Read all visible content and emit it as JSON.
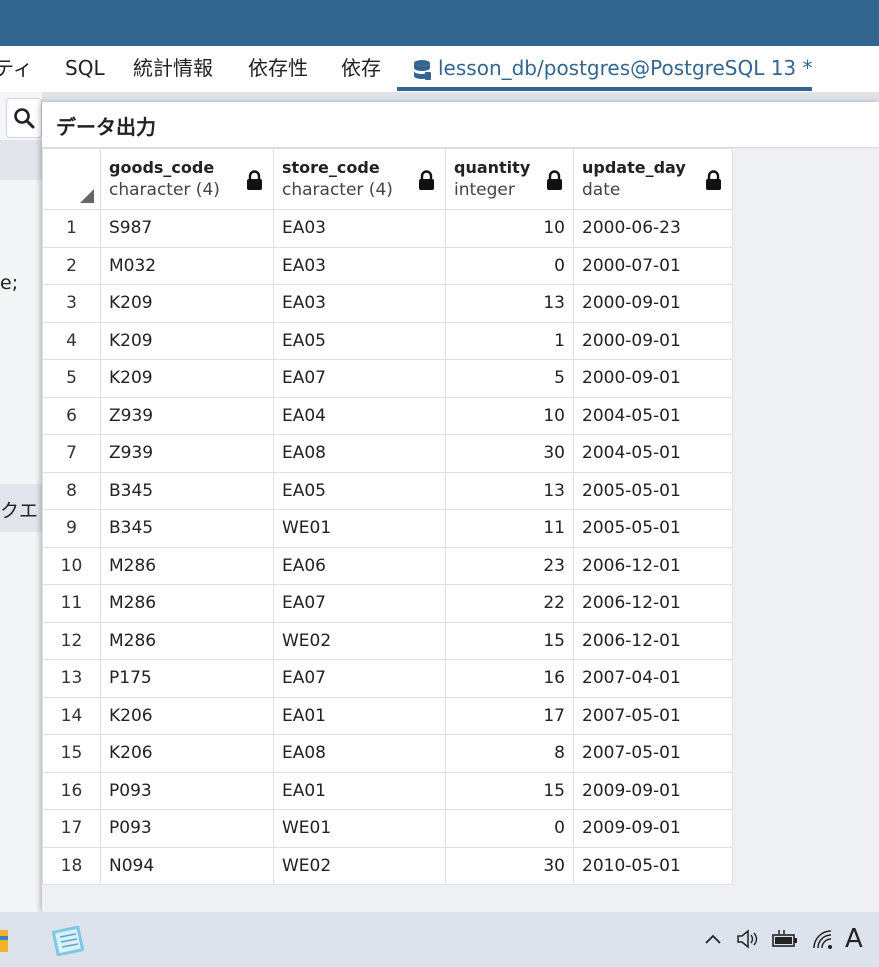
{
  "tabs": [
    {
      "label": "ティ"
    },
    {
      "label": "SQL"
    },
    {
      "label": "統計情報"
    },
    {
      "label": "依存性"
    },
    {
      "label": "依存"
    },
    {
      "label": "lesson_db/postgres@PostgreSQL 13 *"
    }
  ],
  "background_fragments": {
    "code_fragment": "e;",
    "query_fragment": "クエ"
  },
  "panel": {
    "title": "データ出力"
  },
  "columns": [
    {
      "name": "goods_code",
      "type": "character (4)"
    },
    {
      "name": "store_code",
      "type": "character (4)"
    },
    {
      "name": "quantity",
      "type": "integer"
    },
    {
      "name": "update_day",
      "type": "date"
    }
  ],
  "rows": [
    {
      "n": "1",
      "goods": "S987",
      "store": "EA03",
      "qty": "10",
      "date": "2000-06-23"
    },
    {
      "n": "2",
      "goods": "M032",
      "store": "EA03",
      "qty": "0",
      "date": "2000-07-01"
    },
    {
      "n": "3",
      "goods": "K209",
      "store": "EA03",
      "qty": "13",
      "date": "2000-09-01"
    },
    {
      "n": "4",
      "goods": "K209",
      "store": "EA05",
      "qty": "1",
      "date": "2000-09-01"
    },
    {
      "n": "5",
      "goods": "K209",
      "store": "EA07",
      "qty": "5",
      "date": "2000-09-01"
    },
    {
      "n": "6",
      "goods": "Z939",
      "store": "EA04",
      "qty": "10",
      "date": "2004-05-01"
    },
    {
      "n": "7",
      "goods": "Z939",
      "store": "EA08",
      "qty": "30",
      "date": "2004-05-01"
    },
    {
      "n": "8",
      "goods": "B345",
      "store": "EA05",
      "qty": "13",
      "date": "2005-05-01"
    },
    {
      "n": "9",
      "goods": "B345",
      "store": "WE01",
      "qty": "11",
      "date": "2005-05-01"
    },
    {
      "n": "10",
      "goods": "M286",
      "store": "EA06",
      "qty": "23",
      "date": "2006-12-01"
    },
    {
      "n": "11",
      "goods": "M286",
      "store": "EA07",
      "qty": "22",
      "date": "2006-12-01"
    },
    {
      "n": "12",
      "goods": "M286",
      "store": "WE02",
      "qty": "15",
      "date": "2006-12-01"
    },
    {
      "n": "13",
      "goods": "P175",
      "store": "EA07",
      "qty": "16",
      "date": "2007-04-01"
    },
    {
      "n": "14",
      "goods": "K206",
      "store": "EA01",
      "qty": "17",
      "date": "2007-05-01"
    },
    {
      "n": "15",
      "goods": "K206",
      "store": "EA08",
      "qty": "8",
      "date": "2007-05-01"
    },
    {
      "n": "16",
      "goods": "P093",
      "store": "EA01",
      "qty": "15",
      "date": "2009-09-01"
    },
    {
      "n": "17",
      "goods": "P093",
      "store": "WE01",
      "qty": "0",
      "date": "2009-09-01"
    },
    {
      "n": "18",
      "goods": "N094",
      "store": "WE02",
      "qty": "30",
      "date": "2010-05-01"
    }
  ],
  "taskbar": {
    "ime_label": "A"
  },
  "colors": {
    "titlebar": "#326690",
    "accent": "#326690",
    "taskbar": "#dde3ec"
  }
}
